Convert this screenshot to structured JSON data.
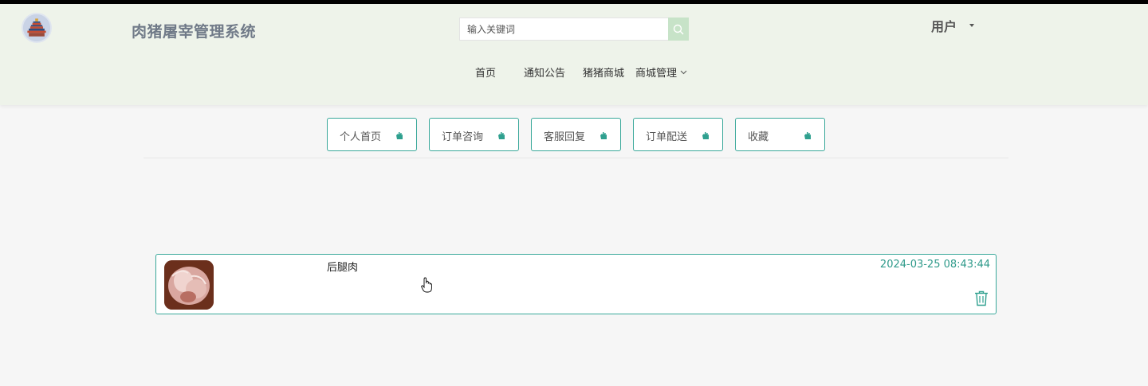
{
  "app": {
    "title": "肉猪屠宰管理系统"
  },
  "header": {
    "logo_icon": "temple-emblem-icon",
    "search": {
      "placeholder": "输入关键词",
      "value": "",
      "icon": "search-icon"
    },
    "user": {
      "label": "用户",
      "icon": "caret-down-icon"
    }
  },
  "nav": {
    "items": [
      {
        "label": "首页"
      },
      {
        "label": "通知公告"
      },
      {
        "label": "猪猪商城"
      },
      {
        "label": "商城管理",
        "icon": "chevron-down-icon"
      }
    ]
  },
  "tabs": [
    {
      "label": "个人首页",
      "icon": "hand-icon"
    },
    {
      "label": "订单咨询",
      "icon": "hand-icon"
    },
    {
      "label": "客服回复",
      "icon": "hand-icon"
    },
    {
      "label": "订单配送",
      "icon": "hand-icon"
    },
    {
      "label": "收藏",
      "icon": "hand-icon"
    }
  ],
  "favorites": [
    {
      "name": "后腿肉",
      "time": "2024-03-25 08:43:44",
      "thumbnail_icon": "pork-meat-image",
      "delete_icon": "trash-icon"
    }
  ],
  "colors": {
    "header_bg": "#eef3ea",
    "accent": "#3aa89a",
    "page_bg": "#f6f6f6",
    "search_button": "#c7e3c8"
  }
}
